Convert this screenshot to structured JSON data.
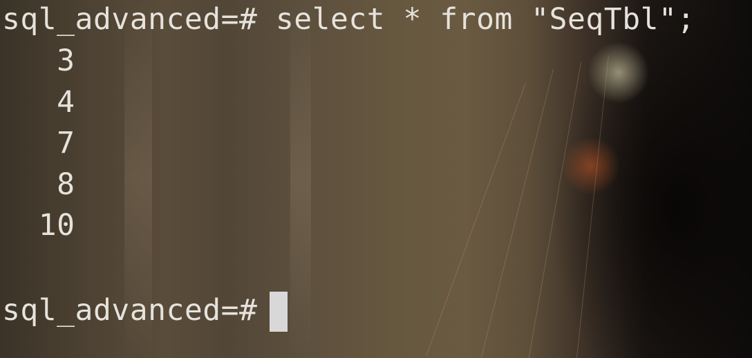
{
  "terminal": {
    "command_line": "sql_advanced=# select * from \"SeqTbl\";",
    "results": [
      "   3",
      "   4",
      "   7",
      "   8",
      "  10"
    ],
    "prompt": "sql_advanced=# "
  }
}
